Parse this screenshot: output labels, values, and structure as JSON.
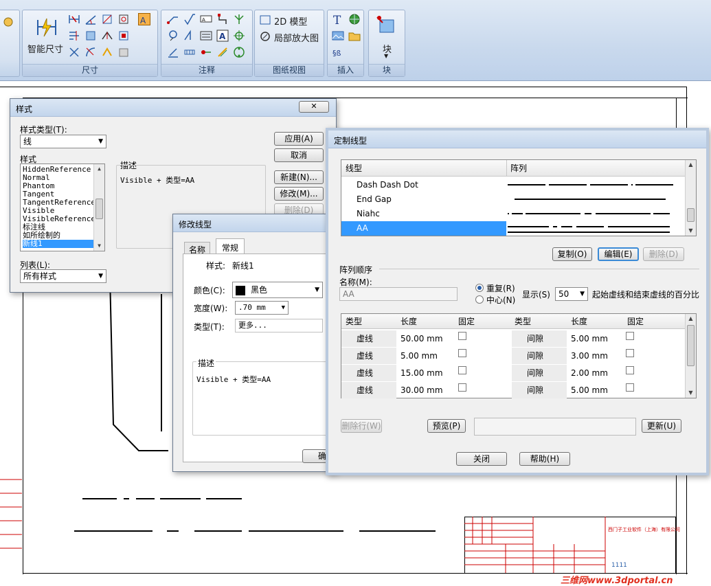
{
  "ribbon": {
    "groups": [
      {
        "label": "尺寸",
        "big_button": "智能尺寸"
      },
      {
        "label": "注释"
      },
      {
        "label": "图纸视图",
        "items": [
          "2D 模型",
          "局部放大图"
        ]
      },
      {
        "label": "插入"
      },
      {
        "label": "块",
        "big_button": "块"
      }
    ]
  },
  "style_dialog": {
    "title": "样式",
    "type_label": "样式类型(T):",
    "type_value": "线",
    "styles_label": "样式",
    "styles": [
      "HiddenReference",
      "Normal",
      "Phantom",
      "Tangent",
      "TangentReference",
      "Visible",
      "VisibleReference",
      "标注线",
      "如所绘制的",
      "新线1"
    ],
    "selected_style": "新线1",
    "desc_label": "描述",
    "desc_value": "Visible + 类型=AA",
    "list_label": "列表(L):",
    "list_value": "所有样式",
    "buttons": {
      "apply": "应用(A)",
      "cancel": "取消",
      "new": "新建(N)...",
      "modify": "修改(M)...",
      "delete": "删除(D)"
    }
  },
  "modify_dialog": {
    "title": "修改线型",
    "tabs": [
      "名称",
      "常规"
    ],
    "style_label": "样式:",
    "style_value": "新线1",
    "color_label": "颜色(C):",
    "color_value": "黑色",
    "width_label": "宽度(W):",
    "width_value": ".70 mm",
    "type_label": "类型(T):",
    "type_value": "更多...",
    "desc_label": "描述",
    "desc_value": "Visible + 类型=AA",
    "ok_fragment": "确"
  },
  "custom_dialog": {
    "title": "定制线型",
    "list_headers": [
      "线型",
      "阵列"
    ],
    "linetypes": [
      "Dash Dash Dot",
      "End Gap",
      "Niahc",
      "AA"
    ],
    "selected_linetype": "AA",
    "copy_btn": "复制(O)",
    "edit_btn": "编辑(E)",
    "delete_btn": "删除(D)",
    "array_order_label": "阵列顺序",
    "name_label": "名称(M):",
    "name_value": "AA",
    "repeat_label": "重复(R)",
    "center_label": "中心(N)",
    "display_label": "显示(S)",
    "display_value": "50",
    "percent_label": "起始虚线和结束虚线的百分比",
    "table_headers": [
      "类型",
      "长度",
      "固定",
      "类型",
      "长度",
      "固定"
    ],
    "rows": [
      [
        "虚线",
        "50.00 mm",
        "间隙",
        "5.00 mm"
      ],
      [
        "虚线",
        "5.00 mm",
        "间隙",
        "3.00 mm"
      ],
      [
        "虚线",
        "15.00 mm",
        "间隙",
        "2.00 mm"
      ],
      [
        "虚线",
        "30.00 mm",
        "间隙",
        "5.00 mm"
      ]
    ],
    "delete_row_btn": "删除行(W)",
    "preview_btn": "预览(P)",
    "update_btn": "更新(U)",
    "close_btn": "关闭",
    "help_btn": "帮助(H)"
  },
  "titleblock": {
    "company": "西门子工业软件（上海）有限公司",
    "number": "1111"
  },
  "watermark": "三维网www.3dportal.cn",
  "colors": {
    "selection": "#3399ff",
    "accent": "#2a5fa8",
    "ribbon": "#c9d9ed"
  }
}
